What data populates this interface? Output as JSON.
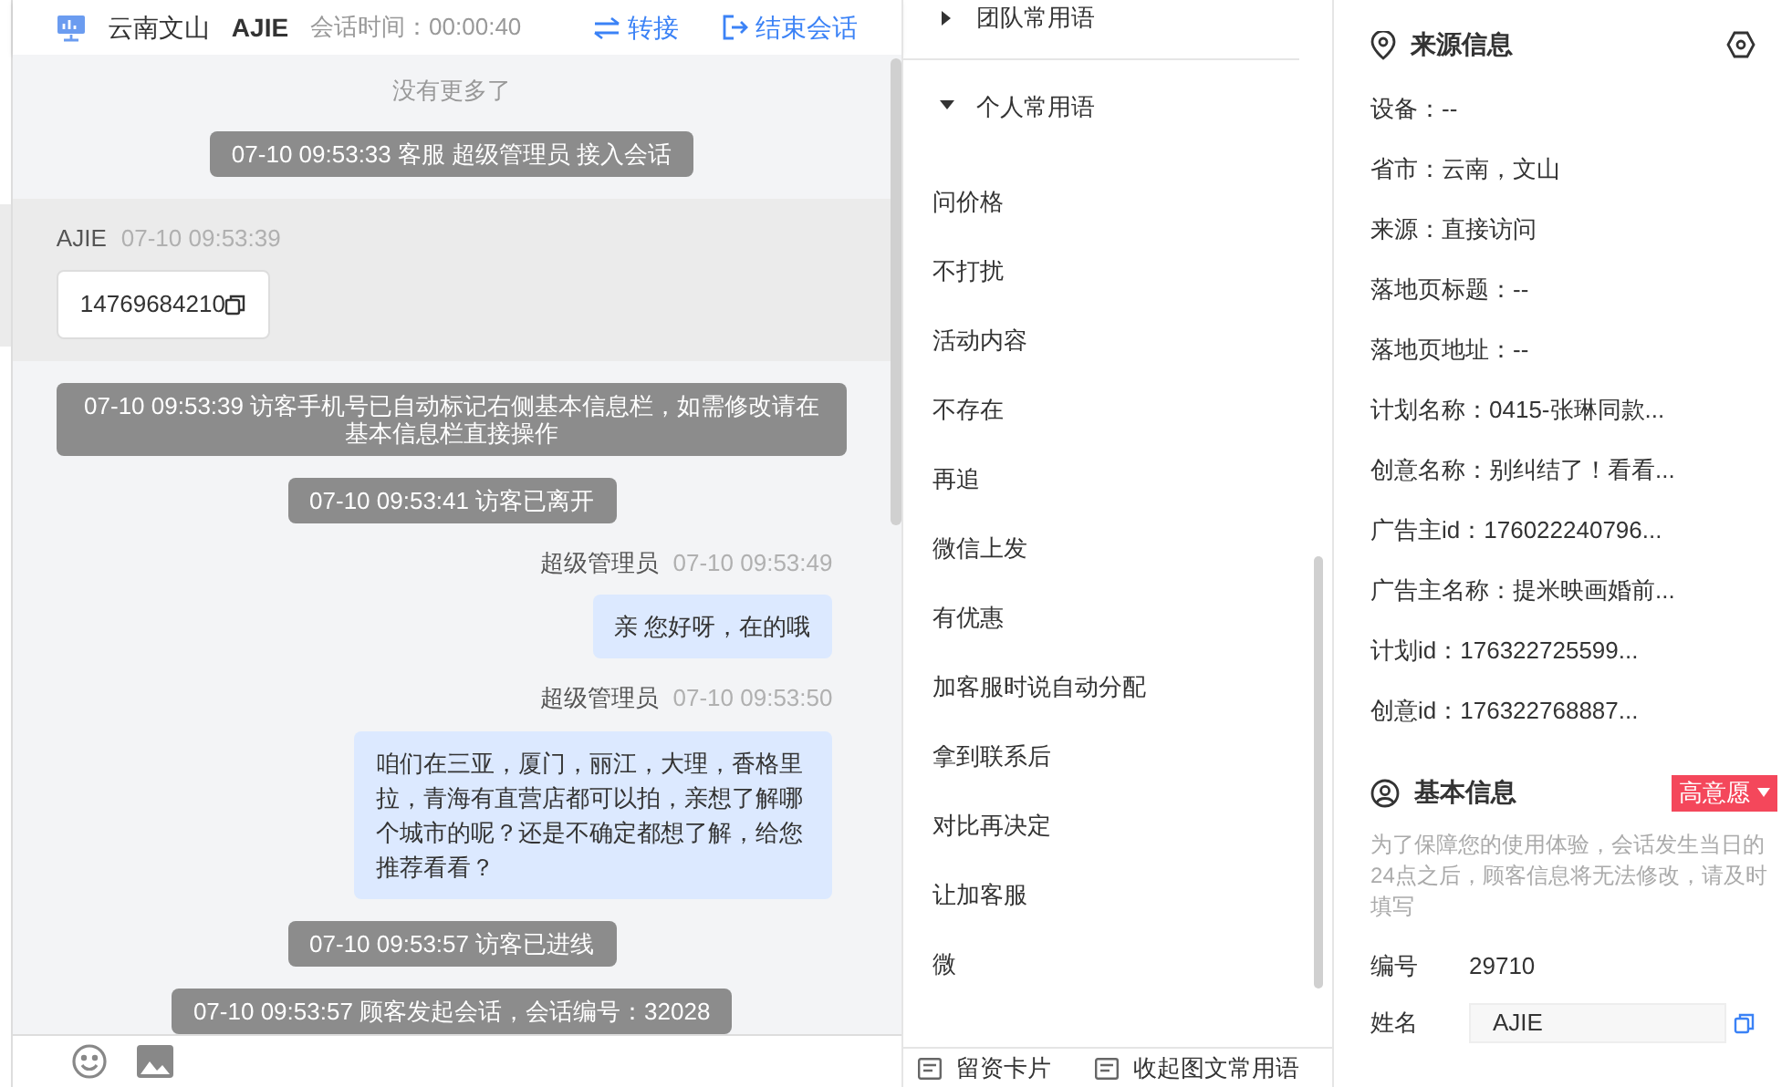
{
  "header": {
    "location": "云南文山",
    "name": "AJIE",
    "duration": "会话时间：00:00:40",
    "actions": [
      {
        "kind": "transfer",
        "label": "转接"
      },
      {
        "kind": "end",
        "label": "结束会话"
      }
    ]
  },
  "chat": {
    "no_more": "没有更多了",
    "messages": [
      {
        "kind": "notice",
        "text": "07-10 09:53:33 客服 超级管理员 接入会话"
      },
      {
        "kind": "visitor",
        "sender": "AJIE",
        "time": "07-10 09:53:39",
        "text": "14769684210"
      },
      {
        "kind": "notice",
        "text": "07-10 09:53:39 访客手机号已自动标记右侧基本信息栏，如需修改请在基本信息栏直接操作"
      },
      {
        "kind": "notice",
        "text": "07-10 09:53:41 访客已离开"
      },
      {
        "kind": "agent",
        "sender": "超级管理员",
        "time": "07-10 09:53:49",
        "text": "亲 您好呀，在的哦"
      },
      {
        "kind": "agent",
        "sender": "超级管理员",
        "time": "07-10 09:53:50",
        "text": "咱们在三亚，厦门，丽江，大理，香格里拉，青海有直营店都可以拍，亲想了解哪个城市的呢？还是不确定都想了解，给您推荐看看？"
      },
      {
        "kind": "notice",
        "text": "07-10 09:53:57 访客已进线"
      },
      {
        "kind": "notice",
        "text": "07-10 09:53:57 顾客发起会话，会话编号：32028"
      }
    ]
  },
  "phrases": {
    "groups": [
      {
        "label": "团队常用语",
        "expanded": false
      },
      {
        "label": "个人常用语",
        "expanded": true,
        "items": [
          "问价格",
          "不打扰",
          "活动内容",
          "不存在",
          "再追",
          "微信上发",
          "有优惠",
          "加客服时说自动分配",
          "拿到联系后",
          "对比再决定",
          "让加客服",
          "微"
        ]
      }
    ],
    "footer": [
      {
        "label": "留资卡片"
      },
      {
        "label": "收起图文常用语"
      }
    ]
  },
  "source_info": {
    "title": "来源信息",
    "fields": [
      "设备：--",
      "省市：云南，文山",
      "来源：直接访问",
      "落地页标题：--",
      "落地页地址：--",
      "计划名称：0415-张琳同款...",
      "创意名称：别纠结了！看看...",
      "广告主id：176022240796...",
      "广告主名称：提米映画婚前...",
      "计划id：176322725599...",
      "创意id：176322768887..."
    ]
  },
  "basic_info": {
    "title": "基本信息",
    "tag": "高意愿",
    "notice": "为了保障您的使用体验，会话发生当日的24点之后，顾客信息将无法修改，请及时填写",
    "fields": [
      {
        "kind": "text",
        "label": "编号",
        "value": "29710"
      },
      {
        "kind": "input",
        "label": "姓名",
        "value": "AJIE"
      }
    ]
  }
}
